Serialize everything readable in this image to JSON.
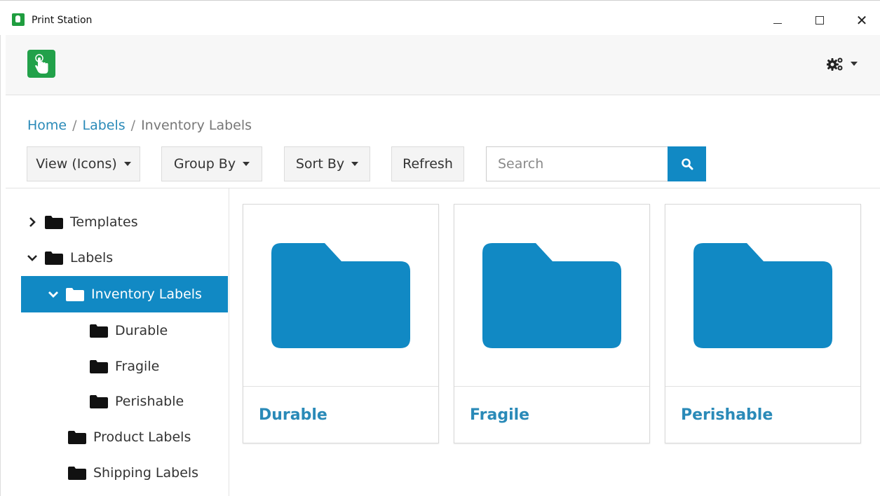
{
  "window": {
    "title": "Print Station",
    "controls": [
      "minimize",
      "maximize",
      "close"
    ]
  },
  "header": {
    "logo_icon": "touch-hand-icon",
    "settings_icon": "gears-icon"
  },
  "breadcrumb": {
    "home": "Home",
    "labels": "Labels",
    "current": "Inventory Labels",
    "separator": "/"
  },
  "toolbar": {
    "view_label": "View (Icons)",
    "group_label": "Group By",
    "sort_label": "Sort By",
    "refresh_label": "Refresh",
    "search_placeholder": "Search"
  },
  "tree": {
    "items": [
      {
        "label": "Templates",
        "expander": "collapsed"
      },
      {
        "label": "Labels",
        "expander": "expanded"
      },
      {
        "label": "Inventory Labels",
        "expander": "expanded",
        "selected": true
      },
      {
        "label": "Durable"
      },
      {
        "label": "Fragile"
      },
      {
        "label": "Perishable"
      },
      {
        "label": "Product Labels"
      },
      {
        "label": "Shipping Labels"
      }
    ]
  },
  "cards": [
    {
      "label": "Durable",
      "icon": "folder-icon"
    },
    {
      "label": "Fragile",
      "icon": "folder-icon"
    },
    {
      "label": "Perishable",
      "icon": "folder-icon"
    }
  ],
  "colors": {
    "accent": "#1189c4",
    "link": "#2a8ab8",
    "logo": "#22a14a"
  }
}
